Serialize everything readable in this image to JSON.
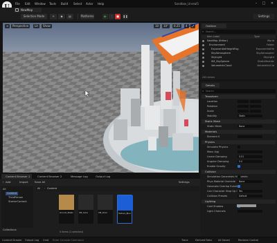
{
  "titlebar": {
    "menus": [
      "File",
      "Edit",
      "Window",
      "Tools",
      "Build",
      "Select",
      "Actor",
      "Help"
    ],
    "project": "Sandbox_Unreal5",
    "level_tab": "NewMap"
  },
  "toolbar": {
    "buttons": [
      "Selection Mode",
      "Platforms"
    ],
    "play_controls": [
      "Play",
      "Play Options",
      "Stop"
    ],
    "settings_label": "Settings"
  },
  "viewport": {
    "buttons": [
      "Perspective",
      "Lit",
      "Show"
    ],
    "grid_value": "10",
    "angle_value": "10°",
    "scale_value": "0.25",
    "camera_speed": "4",
    "colors": {
      "sky": "#62728b",
      "ground_light": "#8f8f8f",
      "ground_dark": "#6d6d6d",
      "accent": "#e6742b"
    }
  },
  "outliner": {
    "tab": "Outliner",
    "search_placeholder": "Search...",
    "header_label": "Item Label",
    "header_type": "Type",
    "rows": [
      {
        "label": "NewMap (Editor)",
        "type": "World"
      },
      {
        "label": "Environment",
        "type": "Folder"
      },
      {
        "label": "ExponentialHeightFog",
        "type": "ExponentialHe"
      },
      {
        "label": "SkyAtmosphere",
        "type": "SkyAtmospher"
      },
      {
        "label": "SkyLight",
        "type": "SkyLight"
      },
      {
        "label": "SM_SkySphere",
        "type": "StaticMeshAc"
      },
      {
        "label": "VolumetricCloud",
        "type": "VolumetricClo"
      }
    ],
    "footer": "245 actors"
  },
  "details": {
    "tab": "Details",
    "search_placeholder": "Search",
    "sections": [
      {
        "title": "Transform",
        "props": [
          {
            "name": "Location",
            "value": ""
          },
          {
            "name": "Rotation",
            "value": ""
          },
          {
            "name": "Scale",
            "value": ""
          },
          {
            "name": "Mobility",
            "value": "Static"
          }
        ]
      },
      {
        "title": "Static Mesh",
        "props": [
          {
            "name": "Static Mesh",
            "value": "None"
          }
        ]
      },
      {
        "title": "Materials",
        "props": [
          {
            "name": "Element 0",
            "value": ""
          }
        ]
      },
      {
        "title": "Physics",
        "props": [
          {
            "name": "Simulate Physics",
            "value": ""
          },
          {
            "name": "Mass (kg)",
            "value": ""
          },
          {
            "name": "Linear Damping",
            "value": "0.01"
          },
          {
            "name": "Angular Damping",
            "value": "0.0"
          },
          {
            "name": "Enable Gravity",
            "value": ""
          }
        ]
      },
      {
        "title": "Collision",
        "props": [
          {
            "name": "Simulation Generates Hit Events",
            "value": ""
          },
          {
            "name": "Phys Material Override",
            "value": "None"
          },
          {
            "name": "Generate Overlap Events",
            "value": ""
          },
          {
            "name": "Can Character Step Up On",
            "value": "Yes"
          },
          {
            "name": "Collision Presets",
            "value": "Default"
          }
        ]
      },
      {
        "title": "Lighting",
        "props": [
          {
            "name": "Cast Shadow",
            "value": ""
          },
          {
            "name": "Light Channels",
            "value": ""
          }
        ]
      }
    ]
  },
  "bottom_tabs": [
    "Content Browser 1",
    "Content Browser 2",
    "Message Log",
    "Output Log"
  ],
  "content_browser": {
    "toolbar": [
      "Add",
      "Import",
      "Save All",
      "Settings"
    ],
    "path": [
      "All",
      "Content"
    ],
    "search_placeholder": "Search Content",
    "tree": [
      "All",
      "Content",
      "ThirdPerson",
      "StarterContent",
      "Collections"
    ],
    "assets": [
      {
        "name": "Ground_Material",
        "color": "#b68a4a"
      },
      {
        "name": "SM_Cube",
        "color": "#2a2a2a"
      },
      {
        "name": "SM_Chair",
        "color": "#2a2a2a"
      },
      {
        "name": "SM_Table",
        "color": "#2a2a2a"
      },
      {
        "name": "Texture_Blue",
        "color": "#1b5ed6"
      }
    ],
    "item_count": "5 items (1 selected)"
  },
  "status": {
    "items": [
      "Content Drawer",
      "Output Log",
      "Cmd",
      "Enter Console Command"
    ],
    "right": [
      "Trace",
      "Derived Data",
      "All Saved",
      "Revision Control"
    ]
  }
}
